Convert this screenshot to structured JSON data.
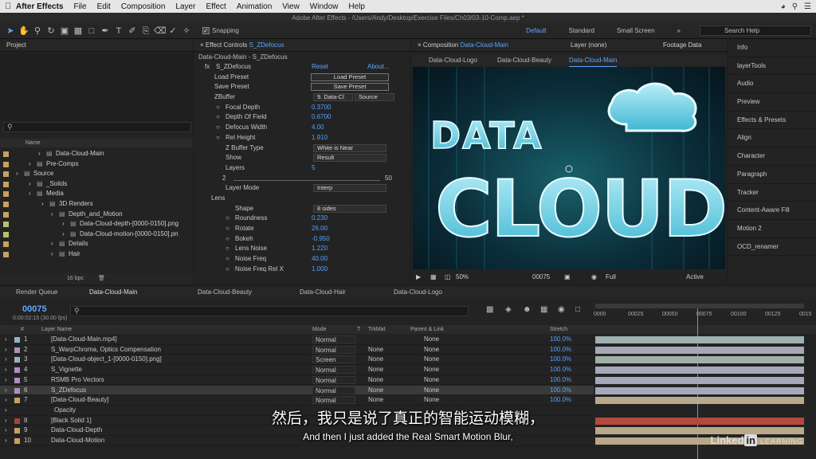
{
  "menubar": {
    "app": "After Effects",
    "items": [
      "File",
      "Edit",
      "Composition",
      "Layer",
      "Effect",
      "Animation",
      "View",
      "Window",
      "Help"
    ]
  },
  "window": {
    "title": "Adobe After Effects - /Users/Andy/Desktop/Exercise Files/Ch03/03-10-Comp.aep *"
  },
  "toolbar": {
    "snapping": "Snapping",
    "workspaces": [
      "Default",
      "Standard",
      "Small Screen"
    ],
    "search_help": "Search Help"
  },
  "project": {
    "tab": "Project",
    "col_name": "Name",
    "bpc": "16 bpc",
    "items": [
      {
        "name": "Data-Cloud-Main",
        "indent": 60,
        "color": "#c8a060"
      },
      {
        "name": "Pre-Comps",
        "indent": 48,
        "color": "#c8a060"
      },
      {
        "name": "Source",
        "indent": 32,
        "color": "#c8a060"
      },
      {
        "name": "_Solids",
        "indent": 48,
        "color": "#c8a060"
      },
      {
        "name": "Media",
        "indent": 48,
        "color": "#c8a060"
      },
      {
        "name": "3D Renders",
        "indent": 64,
        "color": "#c8a060"
      },
      {
        "name": "Depth_and_Motion",
        "indent": 76,
        "color": "#c8a060"
      },
      {
        "name": "Data-Cloud-depth-[0000-0150].png",
        "indent": 90,
        "color": "#b8c070"
      },
      {
        "name": "Data-Cloud-motion-[0000-0150].pn",
        "indent": 90,
        "color": "#b8c070"
      },
      {
        "name": "Details",
        "indent": 76,
        "color": "#c8a060"
      },
      {
        "name": "Hair",
        "indent": 76,
        "color": "#c8a060"
      }
    ]
  },
  "effect_controls": {
    "tab": "Effect Controls",
    "tab_target": "S_ZDefocus",
    "path": "Data-Cloud-Main - S_ZDefocus",
    "fx_name": "S_ZDefocus",
    "reset": "Reset",
    "about": "About...",
    "load_preset": "Load Preset",
    "save_preset": "Save Preset",
    "zbuffer": "ZBuffer",
    "zbuffer_layer": "9. Data-Cl",
    "zbuffer_source": "Source",
    "params": [
      {
        "label": "Focal Depth",
        "value": "0.3700"
      },
      {
        "label": "Depth Of Field",
        "value": "0.6700"
      },
      {
        "label": "Defocus Width",
        "value": "4.00"
      },
      {
        "label": "Rel Height",
        "value": "1.910"
      }
    ],
    "zbuffer_type": "Z Buffer Type",
    "zbuffer_type_value": "White is Near",
    "show": "Show",
    "show_value": "Result",
    "layers": "Layers",
    "layers_value": "5",
    "slider_min": "2",
    "slider_max": "50",
    "layer_mode": "Layer Mode",
    "layer_mode_value": "Interp",
    "lens": "Lens",
    "shape": "Shape",
    "shape_value": "8 sides",
    "lens_params": [
      {
        "label": "Roundness",
        "value": "0.230"
      },
      {
        "label": "Rotate",
        "value": "26.00"
      },
      {
        "label": "Bokeh",
        "value": "-0.950"
      },
      {
        "label": "Lens Noise",
        "value": "1.220"
      },
      {
        "label": "Noise Freq",
        "value": "40.00"
      },
      {
        "label": "Noise Freq Rel X",
        "value": "1.000"
      }
    ]
  },
  "composition": {
    "tab": "Composition",
    "tab_target": "Data-Cloud-Main",
    "layer_tab": "Layer (none)",
    "footage_tab": "Footage Data",
    "breadcrumb": [
      "Data-Cloud-Logo",
      "Data-Cloud-Beauty",
      "Data-Cloud-Main"
    ],
    "art_line1": "DATA",
    "art_line2": "CLOUD",
    "zoom": "50%",
    "timecode": "00075",
    "resolution": "Full",
    "camera": "Active Camera"
  },
  "side_panels": [
    "Info",
    "layerTools",
    "Audio",
    "Preview",
    "Effects & Presets",
    "Align",
    "Character",
    "Paragraph",
    "Tracker",
    "Content-Aware Fill",
    "Motion 2",
    "OCD_renamer"
  ],
  "timeline": {
    "tabs": [
      "Render Queue",
      "Data-Cloud-Main",
      "Data-Cloud-Beauty",
      "Data-Cloud-Hair",
      "Data-Cloud-Logo"
    ],
    "timecode": "00075",
    "timecode_sub": "0:00:02:15 (30.00 fps)",
    "cols": {
      "num": "#",
      "layer_name": "Layer Name",
      "mode": "Mode",
      "t": "T",
      "trkmat": "TrkMat",
      "parent": "Parent & Link",
      "stretch": "Stretch"
    },
    "ruler": [
      "0000",
      "00025",
      "00050",
      "00075",
      "00100",
      "00125",
      "0015"
    ],
    "layers": [
      {
        "num": "1",
        "name": "[Data-Cloud-Main.mp4]",
        "mode": "Normal",
        "trkmat": "",
        "parent": "None",
        "stretch": "100.0%",
        "color": "#8fb5c8",
        "track": "#9fb0b0"
      },
      {
        "num": "2",
        "name": "S_WarpChroma, Optics Compensation",
        "mode": "Normal",
        "trkmat": "None",
        "parent": "None",
        "stretch": "100.0%",
        "color": "#b08fbf",
        "track": "#a7a7b8"
      },
      {
        "num": "3",
        "name": "[Data-Cloud-object_1-[0000-0150].png]",
        "mode": "Screen",
        "trkmat": "None",
        "parent": "None",
        "stretch": "100.0%",
        "color": "#9ab0c5",
        "track": "#9fb0a8"
      },
      {
        "num": "4",
        "name": "S_Vignette",
        "mode": "Normal",
        "trkmat": "None",
        "parent": "None",
        "stretch": "100.0%",
        "color": "#b08fbf",
        "track": "#a8a8bb"
      },
      {
        "num": "5",
        "name": "RSMB Pro Vectors",
        "mode": "Normal",
        "trkmat": "None",
        "parent": "None",
        "stretch": "100.0%",
        "color": "#b08fbf",
        "track": "#a8a8bb"
      },
      {
        "num": "6",
        "name": "S_ZDefocus",
        "mode": "Normal",
        "trkmat": "None",
        "parent": "None",
        "stretch": "100.0%",
        "color": "#b08fbf",
        "track": "#a8a8bb"
      },
      {
        "num": "7",
        "name": "[Data-Cloud-Beauty]",
        "mode": "Normal",
        "trkmat": "None",
        "parent": "None",
        "stretch": "100.0%",
        "color": "#c8a060",
        "track": "#b9a98a"
      },
      {
        "num": "",
        "name": "Opacity",
        "mode": "",
        "trkmat": "",
        "parent": "",
        "stretch": "",
        "color": "",
        "track": ""
      },
      {
        "num": "8",
        "name": "[Black Solid 1]",
        "mode": "",
        "trkmat": "",
        "parent": "",
        "stretch": "",
        "color": "#a84040",
        "track": "#b44a3c"
      },
      {
        "num": "9",
        "name": "Data-Cloud-Depth",
        "mode": "",
        "trkmat": "",
        "parent": "",
        "stretch": "",
        "color": "#c8a060",
        "track": "#b9a98a"
      },
      {
        "num": "10",
        "name": "Data-Cloud-Motion",
        "mode": "",
        "trkmat": "",
        "parent": "",
        "stretch": "",
        "color": "#c8a060",
        "track": "#b9a98a"
      }
    ]
  },
  "subtitles": {
    "zh": "然后，我只是说了真正的智能运动模糊，",
    "en": "And then I just added the Real Smart Motion Blur,"
  },
  "brand": {
    "linked": "Linked",
    "in": "in",
    "learning": "LEARNING"
  }
}
